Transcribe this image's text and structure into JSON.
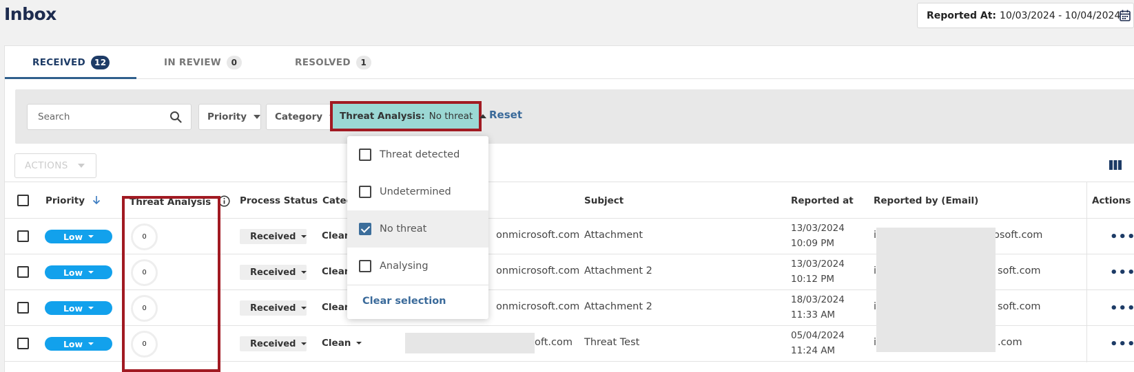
{
  "page": {
    "title": "Inbox"
  },
  "date_filter": {
    "label": "Reported At:",
    "range": "10/03/2024 - 10/04/2024"
  },
  "tabs": [
    {
      "label": "RECEIVED",
      "count": "12",
      "active": true
    },
    {
      "label": "IN REVIEW",
      "count": "0",
      "active": false
    },
    {
      "label": "RESOLVED",
      "count": "1",
      "active": false
    }
  ],
  "filters": {
    "search_placeholder": "Search",
    "priority_label": "Priority",
    "category_label": "Category",
    "threat_label": "Threat Analysis:",
    "threat_value": "No threat",
    "reset_label": "Reset"
  },
  "threat_dropdown": {
    "options": [
      {
        "label": "Threat detected",
        "checked": false
      },
      {
        "label": "Undetermined",
        "checked": false
      },
      {
        "label": "No threat",
        "checked": true
      },
      {
        "label": "Analysing",
        "checked": false
      }
    ],
    "clear_label": "Clear selection"
  },
  "toolbar": {
    "actions_label": "ACTIONS"
  },
  "table": {
    "headers": {
      "priority": "Priority",
      "threat": "Threat Analysis",
      "process_status": "Process Status",
      "category": "Categ",
      "subject": "Subject",
      "reported_at": "Reported at",
      "reported_by": "Reported by (Email)",
      "actions": "Actions"
    },
    "rows": [
      {
        "priority": "Low",
        "threat_score": "0",
        "status": "Received",
        "category": "Clean",
        "reporter_visible": "onmicrosoft.com",
        "subject": "Attachment",
        "date": "13/03/2024",
        "time": "10:09 PM",
        "email_prefix": "i",
        "email_suffix": "osoft.com"
      },
      {
        "priority": "Low",
        "threat_score": "0",
        "status": "Received",
        "category": "Clean",
        "reporter_visible": "onmicrosoft.com",
        "subject": "Attachment 2",
        "date": "13/03/2024",
        "time": "10:12 PM",
        "email_prefix": "i",
        "email_suffix": "soft.com"
      },
      {
        "priority": "Low",
        "threat_score": "0",
        "status": "Received",
        "category": "Clean",
        "reporter_visible": "onmicrosoft.com",
        "subject": "Attachment 2",
        "date": "18/03/2024",
        "time": "11:33 AM",
        "email_prefix": "i",
        "email_suffix": "soft.com"
      },
      {
        "priority": "Low",
        "threat_score": "0",
        "status": "Received",
        "category": "Clean",
        "reporter_visible": "oft.com",
        "subject": "Threat Test",
        "date": "05/04/2024",
        "time": "11:24 AM",
        "email_prefix": "i",
        "email_suffix": ".com"
      }
    ]
  },
  "colors": {
    "brand_navy": "#1d3b66",
    "priority_low": "#12a1ec",
    "threat_filter_bg": "#9bd8d4",
    "highlight_red": "#a11a22",
    "link_blue": "#3a6a9a"
  }
}
